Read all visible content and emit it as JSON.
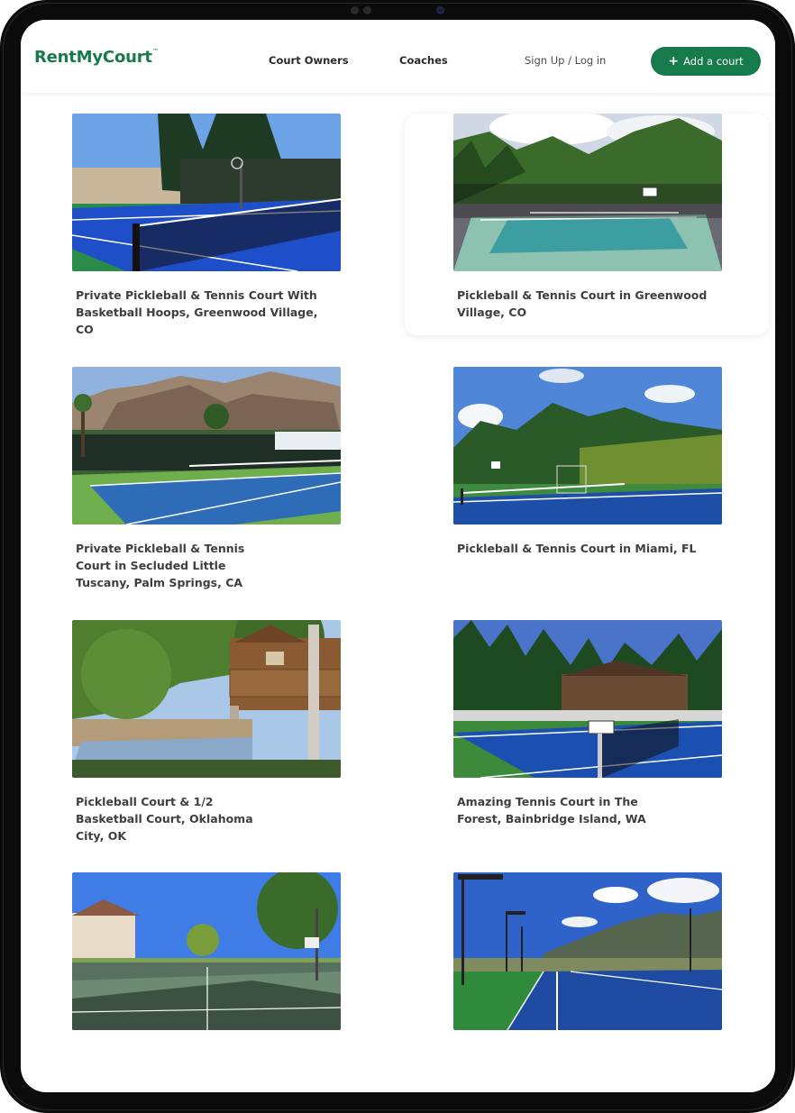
{
  "brand": {
    "logo_text": "RentMyCourt",
    "logo_mark": "™",
    "color": "#177a4c"
  },
  "nav": {
    "links": [
      {
        "label": "Court Owners"
      },
      {
        "label": "Coaches"
      }
    ],
    "login_label": "Sign Up / Log in",
    "cta_label": "Add a court",
    "cta_icon": "plus-icon",
    "cta_color": "#167a4b"
  },
  "courts": [
    {
      "title": "Private Pickleball & Tennis Court With Basketball Hoops, Greenwood Village, CO"
    },
    {
      "title": "Pickleball & Tennis Court in Greenwood Village, CO"
    },
    {
      "title": "Private Pickleball & Tennis Court in Secluded Little Tuscany, Palm Springs, CA"
    },
    {
      "title": "Pickleball & Tennis Court in Miami, FL"
    },
    {
      "title": "Pickleball Court & 1/2 Basketball Court, Oklahoma City, OK"
    },
    {
      "title": "Amazing Tennis Court in The Forest, Bainbridge Island, WA"
    },
    {
      "title": ""
    },
    {
      "title": ""
    }
  ]
}
